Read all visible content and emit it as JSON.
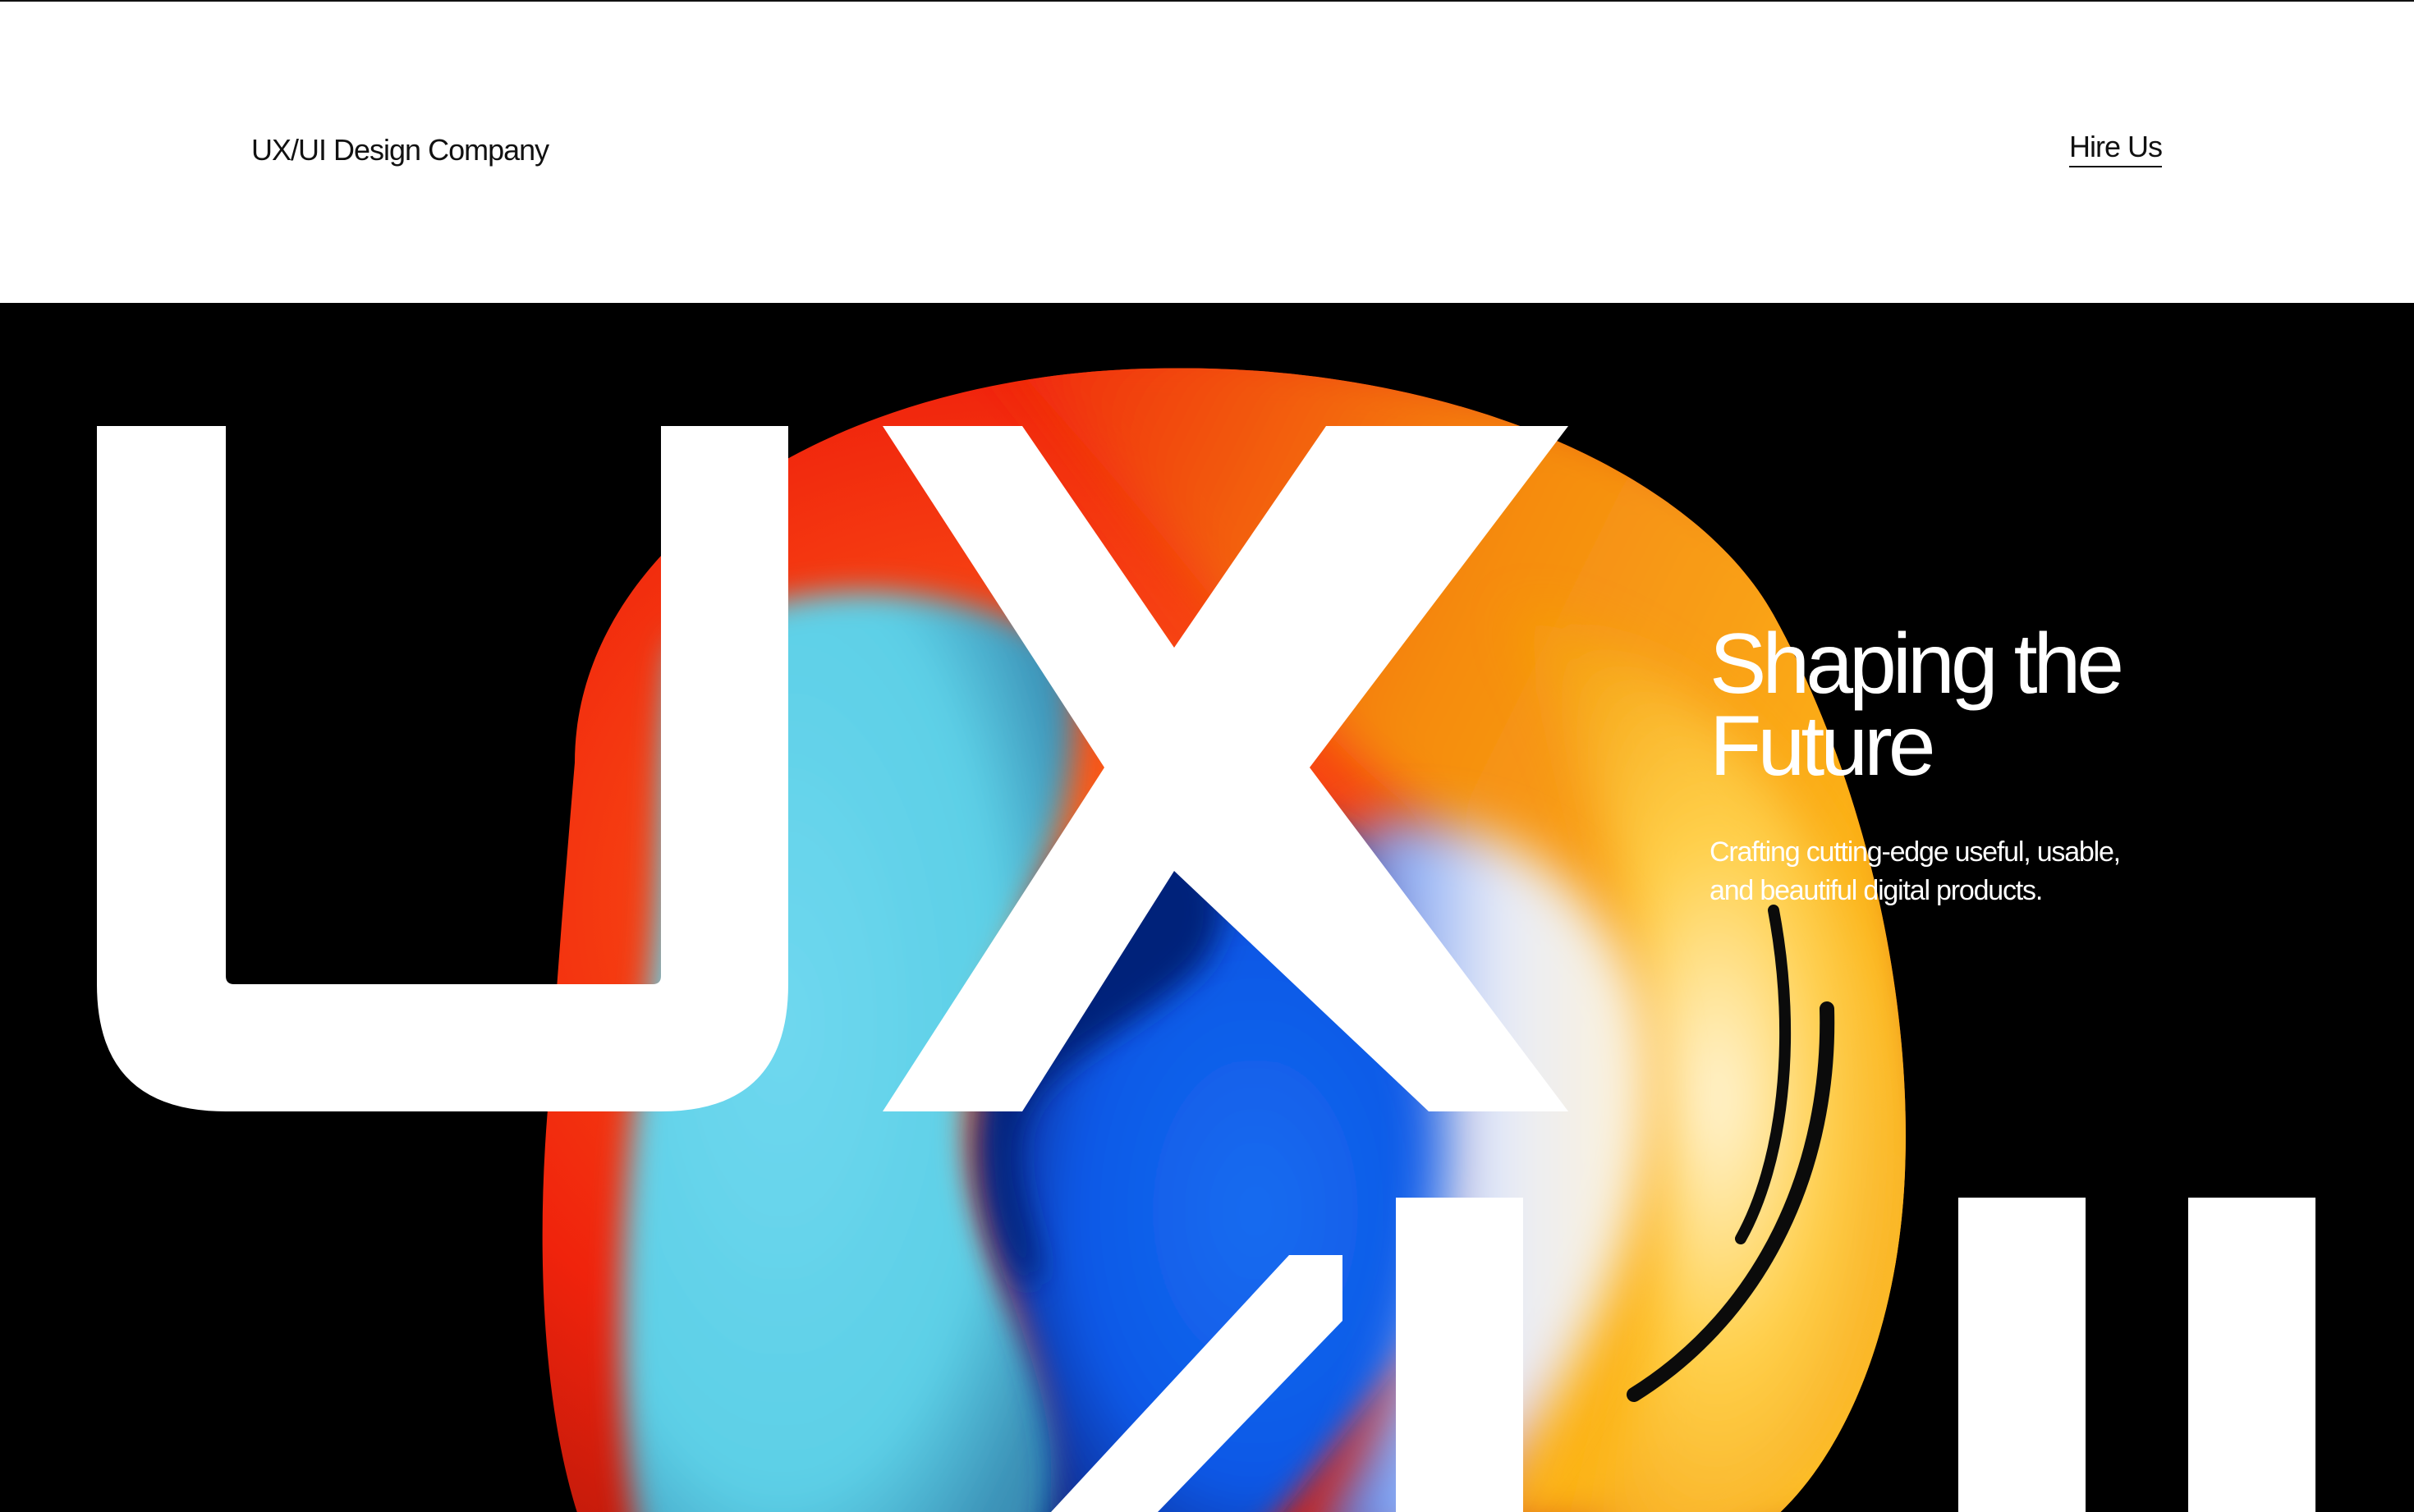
{
  "header": {
    "brand": "UX/UI Design Company",
    "cta_label": "Hire Us"
  },
  "hero": {
    "big_letters_top": "UX",
    "big_letters_bottom": "/UI",
    "headline_line1": "Shaping the",
    "headline_line2": "Future",
    "subtext_line1": "Crafting cutting-edge useful, usable,",
    "subtext_line2": "and beautiful digital products."
  },
  "colors": {
    "background": "#000000",
    "header_bg": "#ffffff",
    "text_dark": "#111111",
    "text_light": "#ffffff",
    "blob_red": "#f0230c",
    "blob_orange": "#f58a10",
    "blob_yellow": "#ffc21a",
    "blob_cyan": "#5ccfe6",
    "blob_blue": "#0b58e6",
    "blob_navy": "#06207a"
  }
}
